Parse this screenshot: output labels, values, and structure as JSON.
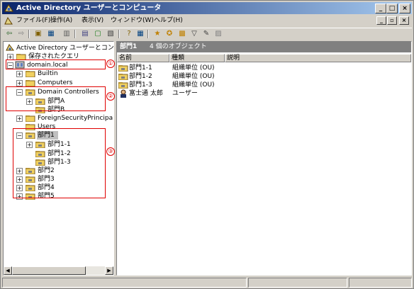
{
  "window": {
    "title": "Active Directory ユーザーとコンピュータ",
    "min": "_",
    "max": "□",
    "close": "×"
  },
  "menu": [
    "ファイル(F)",
    "操作(A)",
    "表示(V)",
    "ウィンドウ(W)",
    "ヘルプ(H)"
  ],
  "mdi": {
    "min": "_",
    "max": "▫",
    "close": "×"
  },
  "toolbar": [
    "⇦",
    "⇨",
    "▣",
    "▦",
    "▥",
    "▤",
    "▢",
    "▧",
    "?",
    "▦",
    "★",
    "✪",
    "▩",
    "▽",
    "✎",
    "▨"
  ],
  "tree": {
    "root": "Active Directory ユーザーとコンピュー",
    "saved_queries": "保存されたクエリ",
    "domain": "domain.local",
    "builtin": "Builtin",
    "computers": "Computers",
    "dc": "Domain Controllers",
    "bumonA": "部門A",
    "bumonB": "部門B",
    "fsp": "ForeignSecurityPrincipals",
    "users": "Users",
    "bumon1": "部門1",
    "bumon1_1": "部門1-1",
    "bumon1_2": "部門1-2",
    "bumon1_3": "部門1-3",
    "bumon2": "部門2",
    "bumon3": "部門3",
    "bumon4": "部門4",
    "bumon5": "部門5"
  },
  "annotations": [
    "①",
    "②",
    "③"
  ],
  "list": {
    "header_title": "部門1",
    "header_count": "4 個のオブジェクト",
    "columns": [
      "名前",
      "種類",
      "説明"
    ],
    "rows": [
      {
        "name": "部門1-1",
        "type": "組織単位 (OU)",
        "desc": ""
      },
      {
        "name": "部門1-2",
        "type": "組織単位 (OU)",
        "desc": ""
      },
      {
        "name": "部門1-3",
        "type": "組織単位 (OU)",
        "desc": ""
      },
      {
        "name": "富士通 太郎",
        "type": "ユーザー",
        "desc": ""
      }
    ]
  },
  "scroll": {
    "left": "◀",
    "right": "▶"
  },
  "colors": {
    "title_start": "#0a246a",
    "title_end": "#a6caf0",
    "annotation_red": "#e00000",
    "folder": "#f0d060"
  }
}
